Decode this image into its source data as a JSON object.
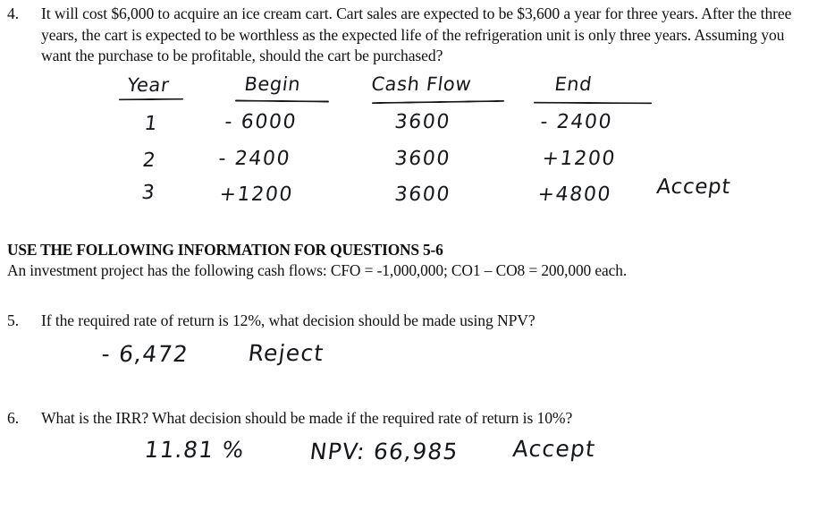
{
  "document": {
    "type": "scanned-worksheet",
    "background_color": "#ffffff",
    "ink_color": "#15171a"
  },
  "questions": [
    {
      "number": "4.",
      "text": "It will cost $6,000 to acquire an ice cream cart. Cart sales are expected to be $3,600 a year for three years. After the three years, the cart is expected to be worthless as the expected life of the refrigeration unit is only three years. Assuming you want the purchase to be profitable, should the cart be purchased?"
    },
    {
      "number": "5.",
      "text": "If the required rate of return is 12%, what decision should be made using NPV?"
    },
    {
      "number": "6.",
      "text": "What is the IRR?  What decision should be made if the required rate of return is 10%?"
    }
  ],
  "section_header": {
    "title": "USE THE FOLLOWING INFORMATION FOR QUESTIONS 5-6",
    "subtitle": "An investment project has the following cash flows:  CFO = -1,000,000; CO1 – CO8 = 200,000 each."
  },
  "handwritten_table": {
    "headers": [
      "Year",
      "Begin",
      "Cash Flow",
      "End"
    ],
    "rows": [
      {
        "year": "1",
        "begin": "- 6000",
        "cash_flow": "3600",
        "end": "- 2400",
        "note": ""
      },
      {
        "year": "2",
        "begin": "- 2400",
        "cash_flow": "3600",
        "end": "+1200",
        "note": ""
      },
      {
        "year": "3",
        "begin": "+1200",
        "cash_flow": "3600",
        "end": "+4800",
        "note": "Accept"
      }
    ]
  },
  "handwritten_answers": {
    "q5": {
      "value": "- 6,472",
      "decision": "Reject"
    },
    "q6": {
      "irr": "11.81 %",
      "npv": "NPV: 66,985",
      "decision": "Accept"
    }
  }
}
